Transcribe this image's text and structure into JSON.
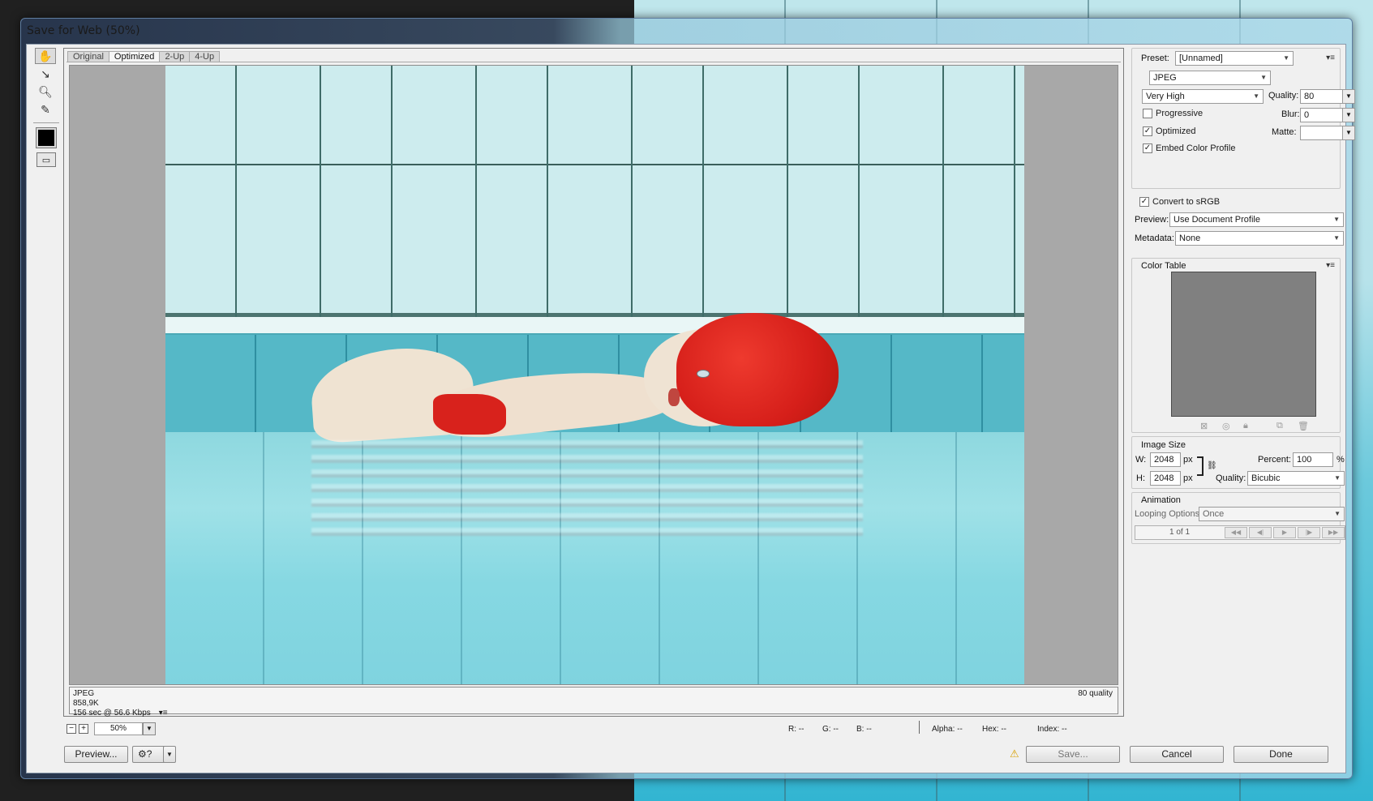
{
  "window": {
    "title": "Save for Web (50%)"
  },
  "tools": [
    {
      "name": "hand-tool",
      "icon": "hand-icon"
    },
    {
      "name": "slice-select-tool",
      "icon": "slice-select-icon"
    },
    {
      "name": "zoom-tool",
      "icon": "magnifier-icon"
    },
    {
      "name": "eyedropper-tool",
      "icon": "eyedropper-icon"
    }
  ],
  "tabs": [
    "Original",
    "Optimized",
    "2-Up",
    "4-Up"
  ],
  "selected_tab": "Optimized",
  "image_info": {
    "format": "JPEG",
    "size": "858,9K",
    "download": "156 sec @ 56.6 Kbps",
    "quality": "80 quality"
  },
  "status": {
    "zoom": "50%",
    "r": "R: --",
    "g": "G: --",
    "b": "B: --",
    "alpha": "Alpha: --",
    "hex": "Hex: --",
    "index": "Index: --"
  },
  "buttons": {
    "preview": "Preview...",
    "save": "Save...",
    "cancel": "Cancel",
    "done": "Done"
  },
  "settings": {
    "preset_label": "Preset:",
    "preset_value": "[Unnamed]",
    "format": "JPEG",
    "quality_preset": "Very High",
    "quality_label": "Quality:",
    "quality_value": "80",
    "progressive_label": "Progressive",
    "progressive_checked": false,
    "blur_label": "Blur:",
    "blur_value": "0",
    "optimized_label": "Optimized",
    "optimized_checked": true,
    "matte_label": "Matte:",
    "matte_value": "",
    "embed_label": "Embed Color Profile",
    "embed_checked": true,
    "srgb_label": "Convert to sRGB",
    "srgb_checked": true,
    "preview_label": "Preview:",
    "preview_value": "Use Document Profile",
    "metadata_label": "Metadata:",
    "metadata_value": "None"
  },
  "color_table": {
    "title": "Color Table"
  },
  "image_size": {
    "title": "Image Size",
    "w_label": "W:",
    "w_value": "2048",
    "h_label": "H:",
    "h_value": "2048",
    "unit": "px",
    "percent_label": "Percent:",
    "percent_value": "100",
    "percent_unit": "%",
    "quality_label": "Quality:",
    "quality_value": "Bicubic"
  },
  "animation": {
    "title": "Animation",
    "looping_label": "Looping Options:",
    "looping_value": "Once",
    "frame_counter": "1 of 1"
  },
  "colors": {
    "client_bg": "#f0f0f0",
    "canvas_gray": "#a8a8a8",
    "warning": "#d8a000"
  }
}
